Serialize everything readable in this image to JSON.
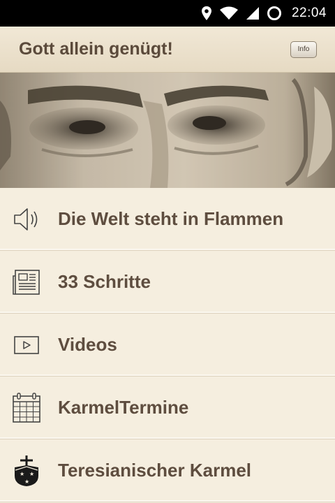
{
  "status_bar": {
    "time": "22:04",
    "icons": [
      "location-icon",
      "wifi-icon",
      "signal-icon",
      "sync-icon"
    ]
  },
  "header": {
    "title": "Gott allein genügt!",
    "info_label": "Info"
  },
  "photo": {
    "icon": "portrait-photo"
  },
  "menu": {
    "items": [
      {
        "label": "Die Welt steht in Flammen",
        "icon": "speaker-icon"
      },
      {
        "label": "33 Schritte",
        "icon": "newspaper-icon"
      },
      {
        "label": "Videos",
        "icon": "video-play-icon"
      },
      {
        "label": "KarmelTermine",
        "icon": "calendar-icon"
      },
      {
        "label": "Teresianischer Karmel",
        "icon": "carmel-emblem-icon"
      }
    ]
  }
}
